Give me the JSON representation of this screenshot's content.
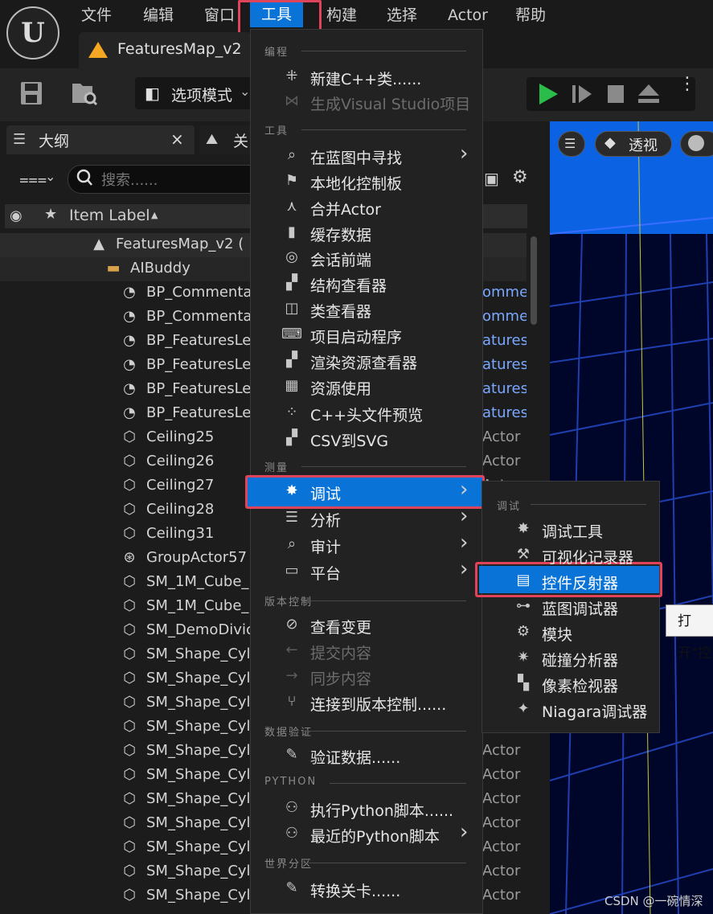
{
  "menubar": {
    "items": [
      "文件",
      "编辑",
      "窗口",
      "工具",
      "构建",
      "选择",
      "Actor",
      "帮助"
    ],
    "active": "工具"
  },
  "tab": {
    "label": "FeaturesMap_v2"
  },
  "toolbar": {
    "mode_label": "选项模式"
  },
  "outliner": {
    "tab_label": "大纲",
    "tab_close": "×",
    "second_tab_label": "关",
    "search_placeholder": "搜索......",
    "column_header": "Item Label",
    "sort_indicator": "▲",
    "rows": [
      {
        "label": "FeaturesMap_v2 (",
        "type": "",
        "icon": "level-icon"
      },
      {
        "label": "AIBuddy",
        "type": "",
        "icon": "folder-icon"
      },
      {
        "label": "BP_Commenta",
        "type": "ommer",
        "icon": "blueprint-actor-icon"
      },
      {
        "label": "BP_Commenta",
        "type": "ommer",
        "icon": "blueprint-actor-icon"
      },
      {
        "label": "BP_FeaturesLe",
        "type": "atures",
        "icon": "blueprint-actor-icon"
      },
      {
        "label": "BP_FeaturesLe",
        "type": "atures",
        "icon": "blueprint-actor-icon"
      },
      {
        "label": "BP_FeaturesLe",
        "type": "atures",
        "icon": "blueprint-actor-icon"
      },
      {
        "label": "BP_FeaturesLe",
        "type": "atures",
        "icon": "blueprint-actor-icon"
      },
      {
        "label": "Ceiling25",
        "type": "Actor",
        "icon": "static-mesh-icon"
      },
      {
        "label": "Ceiling26",
        "type": "Actor",
        "icon": "static-mesh-icon"
      },
      {
        "label": "Ceiling27",
        "type": "Actor",
        "icon": "static-mesh-icon"
      },
      {
        "label": "Ceiling28",
        "type": "",
        "icon": "static-mesh-icon"
      },
      {
        "label": "Ceiling31",
        "type": "",
        "icon": "static-mesh-icon"
      },
      {
        "label": "GroupActor57",
        "type": "",
        "icon": "group-actor-icon"
      },
      {
        "label": "SM_1M_Cube_",
        "type": "",
        "icon": "static-mesh-icon"
      },
      {
        "label": "SM_1M_Cube_",
        "type": "",
        "icon": "static-mesh-icon"
      },
      {
        "label": "SM_DemoDivic",
        "type": "",
        "icon": "static-mesh-icon"
      },
      {
        "label": "SM_Shape_Cyl",
        "type": "",
        "icon": "static-mesh-icon"
      },
      {
        "label": "SM_Shape_Cyl",
        "type": "",
        "icon": "static-mesh-icon"
      },
      {
        "label": "SM_Shape_Cyl",
        "type": "",
        "icon": "static-mesh-icon"
      },
      {
        "label": "SM_Shape_Cyl",
        "type": "Actor",
        "icon": "static-mesh-icon"
      },
      {
        "label": "SM_Shape_Cyl",
        "type": "Actor",
        "icon": "static-mesh-icon"
      },
      {
        "label": "SM_Shape_Cyl",
        "type": "Actor",
        "icon": "static-mesh-icon"
      },
      {
        "label": "SM_Shape_Cyl",
        "type": "Actor",
        "icon": "static-mesh-icon"
      },
      {
        "label": "SM_Shape_Cyl",
        "type": "Actor",
        "icon": "static-mesh-icon"
      },
      {
        "label": "SM_Shape_Cyl",
        "type": "Actor",
        "icon": "static-mesh-icon"
      },
      {
        "label": "SM_Shape_Cyl",
        "type": "Actor",
        "icon": "static-mesh-icon"
      },
      {
        "label": "SM_Shape_Cyl",
        "type": "Actor",
        "icon": "static-mesh-icon"
      }
    ]
  },
  "viewport": {
    "perspective_label": "透视"
  },
  "dropdown": {
    "sections": [
      {
        "title": "编程",
        "items": [
          {
            "label": "新建C++类......",
            "icon": "cpp-class-icon",
            "disabled": false,
            "submenu": false
          },
          {
            "label": "生成Visual Studio项目",
            "icon": "visual-studio-icon",
            "disabled": true,
            "submenu": false
          }
        ]
      },
      {
        "title": "工具",
        "items": [
          {
            "label": "在蓝图中寻找",
            "icon": "find-in-blueprint-icon",
            "disabled": false,
            "submenu": true
          },
          {
            "label": "本地化控制板",
            "icon": "localization-flag-icon",
            "disabled": false,
            "submenu": false
          },
          {
            "label": "合并Actor",
            "icon": "merge-actors-icon",
            "disabled": false,
            "submenu": false
          },
          {
            "label": "缓存数据",
            "icon": "cache-data-icon",
            "disabled": false,
            "submenu": false
          },
          {
            "label": "会话前端",
            "icon": "session-frontend-icon",
            "disabled": false,
            "submenu": false
          },
          {
            "label": "结构查看器",
            "icon": "struct-viewer-icon",
            "disabled": false,
            "submenu": false
          },
          {
            "label": "类查看器",
            "icon": "class-viewer-icon",
            "disabled": false,
            "submenu": false
          },
          {
            "label": "项目启动程序",
            "icon": "project-launcher-icon",
            "disabled": false,
            "submenu": false
          },
          {
            "label": "渲染资源查看器",
            "icon": "render-resource-viewer-icon",
            "disabled": false,
            "submenu": false
          },
          {
            "label": "资源使用",
            "icon": "resource-usage-icon",
            "disabled": false,
            "submenu": false
          },
          {
            "label": "C++头文件预览",
            "icon": "cpp-header-preview-icon",
            "disabled": false,
            "submenu": false
          },
          {
            "label": "CSV到SVG",
            "icon": "csv-to-svg-icon",
            "disabled": false,
            "submenu": false
          }
        ]
      },
      {
        "title": "测量",
        "items": [
          {
            "label": "调试",
            "icon": "debug-bug-icon",
            "disabled": false,
            "submenu": true,
            "active": true
          },
          {
            "label": "分析",
            "icon": "profile-icon",
            "disabled": false,
            "submenu": true
          },
          {
            "label": "审计",
            "icon": "audit-icon",
            "disabled": false,
            "submenu": true
          },
          {
            "label": "平台",
            "icon": "platform-icon",
            "disabled": false,
            "submenu": true
          }
        ]
      },
      {
        "title": "版本控制",
        "items": [
          {
            "label": "查看变更",
            "icon": "view-changes-icon",
            "disabled": false,
            "submenu": false
          },
          {
            "label": "提交内容",
            "icon": "submit-arrow-icon",
            "disabled": true,
            "submenu": false
          },
          {
            "label": "同步内容",
            "icon": "sync-arrow-icon",
            "disabled": true,
            "submenu": false
          },
          {
            "label": "连接到版本控制......",
            "icon": "source-control-branch-icon",
            "disabled": false,
            "submenu": false
          }
        ]
      },
      {
        "title": "数据验证",
        "items": [
          {
            "label": "验证数据......",
            "icon": "validate-data-icon",
            "disabled": false,
            "submenu": false
          }
        ]
      },
      {
        "title": "PYTHON",
        "items": [
          {
            "label": "执行Python脚本......",
            "icon": "python-icon",
            "disabled": false,
            "submenu": false
          },
          {
            "label": "最近的Python脚本",
            "icon": "python-recent-icon",
            "disabled": false,
            "submenu": true
          }
        ]
      },
      {
        "title": "世界分区",
        "items": [
          {
            "label": "转换关卡......",
            "icon": "convert-level-icon",
            "disabled": false,
            "submenu": false
          }
        ]
      }
    ]
  },
  "submenu": {
    "title": "调试",
    "items": [
      {
        "label": "调试工具",
        "icon": "debug-tools-icon"
      },
      {
        "label": "可视化记录器",
        "icon": "visual-logger-icon"
      },
      {
        "label": "控件反射器",
        "icon": "widget-reflector-icon",
        "active": true
      },
      {
        "label": "蓝图调试器",
        "icon": "blueprint-debugger-icon"
      },
      {
        "label": "模块",
        "icon": "modules-gear-icon"
      },
      {
        "label": "碰撞分析器",
        "icon": "collision-analyzer-icon"
      },
      {
        "label": "像素检视器",
        "icon": "pixel-inspector-icon"
      },
      {
        "label": "Niagara调试器",
        "icon": "niagara-debugger-icon"
      }
    ]
  },
  "tooltip": {
    "text": "打开\"控"
  },
  "watermark": {
    "text": "CSDN @一碗情深"
  },
  "colors": {
    "accent": "#0a73d8",
    "highlight_border": "#e0445a",
    "play_green": "#2bbd4a"
  }
}
